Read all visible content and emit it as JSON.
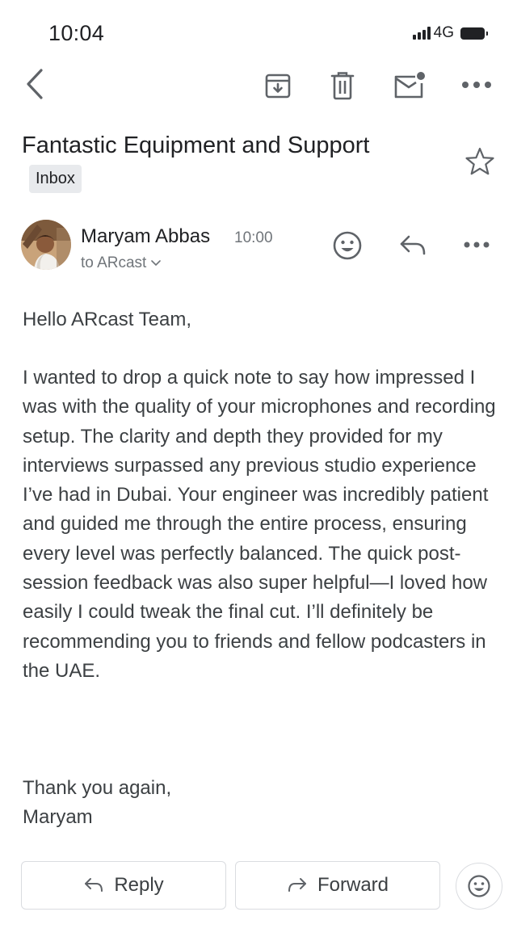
{
  "status_bar": {
    "time": "10:04",
    "network": "4G"
  },
  "toolbar": {
    "back_icon": "chevron-left-icon",
    "archive_icon": "archive-icon",
    "delete_icon": "trash-icon",
    "unread_icon": "mark-unread-icon",
    "more_icon": "more-horizontal-icon"
  },
  "email": {
    "subject": "Fantastic Equipment and Support",
    "label": "Inbox",
    "sender": "Maryam Abbas",
    "time": "10:00",
    "to_line": "to ARcast",
    "greeting": "Hello ARcast Team,",
    "paragraph": "I wanted to drop a quick note to say how impressed I was with the quality of your microphones and recording setup. The clarity and depth they provided for my interviews surpassed any previous studio experience I’ve had in Dubai. Your engineer was incredibly patient and guided me through the entire process, ensuring every level was perfectly balanced. The quick post-session feedback was also super helpful—I loved how easily I could tweak the final cut.  I’ll definitely be recommending you to friends and fellow podcasters in the UAE.",
    "closing_1": "Thank you again,",
    "closing_2": "Maryam"
  },
  "actions": {
    "reply_label": "Reply",
    "forward_label": "Forward"
  },
  "colors": {
    "icon": "#5f6368",
    "text": "#202124",
    "muted": "#70757a",
    "border": "#dadce0"
  }
}
